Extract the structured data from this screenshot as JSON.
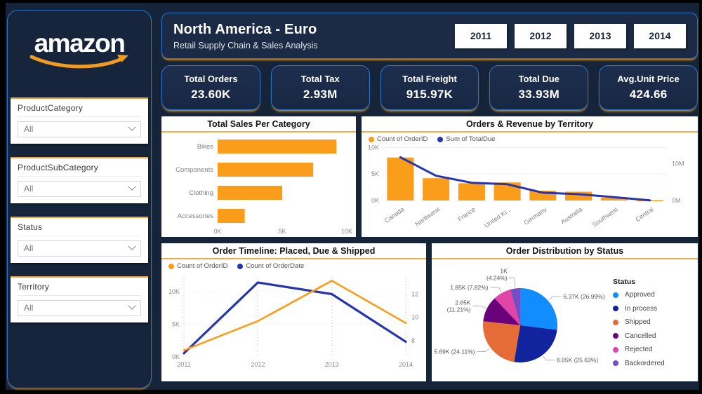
{
  "sidebar": {
    "logo_text": "amazon",
    "filters": [
      {
        "label": "ProductCategory",
        "value": "All"
      },
      {
        "label": "ProductSubCategory",
        "value": "All"
      },
      {
        "label": "Status",
        "value": "All"
      },
      {
        "label": "Territory",
        "value": "All"
      }
    ]
  },
  "header": {
    "title": "North America - Euro",
    "subtitle": "Retail Supply Chain & Sales Analysis",
    "years": [
      "2011",
      "2012",
      "2013",
      "2014"
    ]
  },
  "kpis": [
    {
      "label": "Total Orders",
      "value": "23.60K"
    },
    {
      "label": "Total Tax",
      "value": "2.93M"
    },
    {
      "label": "Total Freight",
      "value": "915.97K"
    },
    {
      "label": "Total Due",
      "value": "33.93M"
    },
    {
      "label": "Avg.Unit Price",
      "value": "424.66"
    }
  ],
  "colors": {
    "bar_orange": "#F99D1B",
    "line_blue": "#2634AE",
    "accent_orange": "#F2A33C",
    "panel_border_blue": "#2E75C8",
    "background_navy": "#16243A"
  },
  "chart_data": [
    {
      "type": "bar",
      "orientation": "horizontal",
      "title": "Total Sales Per Category",
      "categories": [
        "Bikes",
        "Components",
        "Clothing",
        "Accessories"
      ],
      "values": [
        9200,
        7400,
        5000,
        2100
      ],
      "xlim": [
        0,
        10000
      ],
      "xticks": [
        {
          "v": 0,
          "l": "0K"
        },
        {
          "v": 5000,
          "l": "5K"
        },
        {
          "v": 10000,
          "l": "10K"
        }
      ]
    },
    {
      "type": "combo",
      "title": "Orders & Revenue by Territory",
      "categories": [
        "Canada",
        "Northwest",
        "France",
        "United Ki...",
        "Germany",
        "Australia",
        "Southwest",
        "Central"
      ],
      "series": [
        {
          "name": "Count of OrderID",
          "kind": "bar",
          "axis": "left",
          "values": [
            8100,
            4200,
            3250,
            3400,
            1850,
            1650,
            500,
            60
          ]
        },
        {
          "name": "Sum of TotalDue",
          "kind": "line",
          "axis": "right",
          "values": [
            11.7,
            6.7,
            4.8,
            4.4,
            2.1,
            1.7,
            0.9,
            0.05
          ]
        }
      ],
      "left_lim": [
        0,
        10300
      ],
      "left_ticks": [
        {
          "v": 0,
          "l": "0K"
        },
        {
          "v": 5000,
          "l": "5K"
        },
        {
          "v": 10000,
          "l": "10K"
        }
      ],
      "right_lim": [
        0,
        14.8
      ],
      "right_ticks": [
        {
          "v": 0,
          "l": "0M"
        },
        {
          "v": 10,
          "l": "10M"
        }
      ]
    },
    {
      "type": "line",
      "title": "Order Timeline: Placed, Due & Shipped",
      "x": [
        "2011",
        "2012",
        "2013",
        "2014"
      ],
      "series": [
        {
          "name": "Count of OrderID",
          "axis": "left",
          "values": [
            1000,
            5500,
            11700,
            5200
          ]
        },
        {
          "name": "Count of OrderDate",
          "axis": "right",
          "values": [
            6.9,
            13,
            12,
            7.9
          ]
        }
      ],
      "left_lim": [
        0,
        12500
      ],
      "left_ticks": [
        {
          "v": 0,
          "l": "0K"
        },
        {
          "v": 5000,
          "l": "5K"
        },
        {
          "v": 10000,
          "l": "10K"
        }
      ],
      "right_lim": [
        6.6,
        13.6
      ],
      "right_ticks": [
        {
          "v": 8,
          "l": "8"
        },
        {
          "v": 10,
          "l": "10"
        },
        {
          "v": 12,
          "l": "12"
        }
      ]
    },
    {
      "type": "pie",
      "title": "Order Distribution by Status",
      "legend_title": "Status",
      "slices": [
        {
          "name": "Approved",
          "value": "6.37K",
          "pct": 26.99,
          "label_lines": [
            "6.37K (26.99%)"
          ],
          "color": "#118DFF"
        },
        {
          "name": "In process",
          "value": "6.05K",
          "pct": 25.63,
          "label_lines": [
            "6.05K (25.63%)"
          ],
          "color": "#12239E"
        },
        {
          "name": "Shipped",
          "value": "5.69K",
          "pct": 24.11,
          "label_lines": [
            "5.69K (24.11%)"
          ],
          "color": "#E66C37"
        },
        {
          "name": "Cancelled",
          "value": "2.65K",
          "pct": 11.21,
          "label_lines": [
            "2.65K",
            "(11.21%)"
          ],
          "color": "#6B007B"
        },
        {
          "name": "Rejected",
          "value": "1.85K",
          "pct": 7.82,
          "label_lines": [
            "1.85K (7.82%)"
          ],
          "color": "#E044A7"
        },
        {
          "name": "Backordered",
          "value": "1K",
          "pct": 4.24,
          "label_lines": [
            "1K",
            "(4.24%)"
          ],
          "color": "#744EC2"
        }
      ]
    }
  ]
}
